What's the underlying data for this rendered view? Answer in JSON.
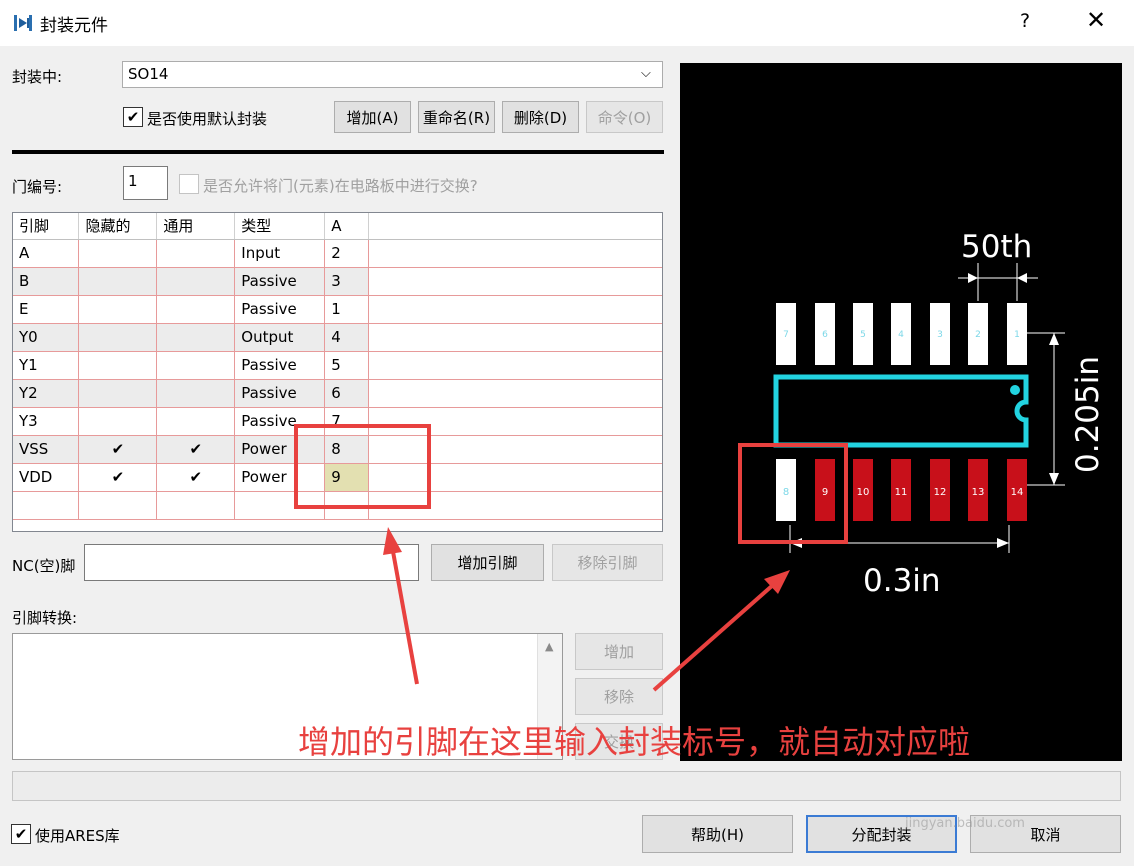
{
  "window": {
    "title": "封装元件",
    "help": "?",
    "close": "✕"
  },
  "package": {
    "label": "封装中:",
    "selected": "SO14"
  },
  "default_package": {
    "checked": true,
    "label": "是否使用默认封装"
  },
  "pkg_buttons": {
    "add": "增加(A)",
    "rename": "重命名(R)",
    "delete": "删除(D)",
    "command": "命令(O)"
  },
  "gate": {
    "label": "门编号:",
    "value": "1",
    "swap_label": "是否允许将门(元素)在电路板中进行交换?"
  },
  "pin_table": {
    "headers": [
      "引脚",
      "隐藏的",
      "通用",
      "类型",
      "A"
    ],
    "rows": [
      [
        "A",
        "",
        "",
        "Input",
        "2"
      ],
      [
        "B",
        "",
        "",
        "Passive",
        "3"
      ],
      [
        "E",
        "",
        "",
        "Passive",
        "1"
      ],
      [
        "Y0",
        "",
        "",
        "Output",
        "4"
      ],
      [
        "Y1",
        "",
        "",
        "Passive",
        "5"
      ],
      [
        "Y2",
        "",
        "",
        "Passive",
        "6"
      ],
      [
        "Y3",
        "",
        "",
        "Passive",
        "7"
      ],
      [
        "VSS",
        "✔",
        "✔",
        "Power",
        "8"
      ],
      [
        "VDD",
        "✔",
        "✔",
        "Power",
        "9"
      ]
    ]
  },
  "nc": {
    "label": "NC(空)脚",
    "add_pin": "增加引脚",
    "remove_pin": "移除引脚"
  },
  "pin_mapping": {
    "label": "引脚转换:",
    "add": "增加",
    "remove": "移除",
    "swap": "交换"
  },
  "footprint": {
    "dim_top": "50th",
    "dim_right": "0.205in",
    "dim_bottom": "0.3in",
    "top_pins": [
      "7",
      "6",
      "5",
      "4",
      "3",
      "2",
      "1"
    ],
    "bottom_pins": [
      "8",
      "9",
      "10",
      "11",
      "12",
      "13",
      "14"
    ]
  },
  "annotation": {
    "text": "增加的引脚在这里输入封装标号，就自动对应啦"
  },
  "footer": {
    "use_ares": "使用ARES库",
    "help": "帮助(H)",
    "assign": "分配封装",
    "cancel": "取消"
  },
  "watermark": {
    "site": "jingyan.baidu.com"
  },
  "colors": {
    "accent": "#e8413f",
    "outline": "#22d3e0",
    "pad_red": "#c8101a",
    "pad_white": "#ffffff"
  }
}
